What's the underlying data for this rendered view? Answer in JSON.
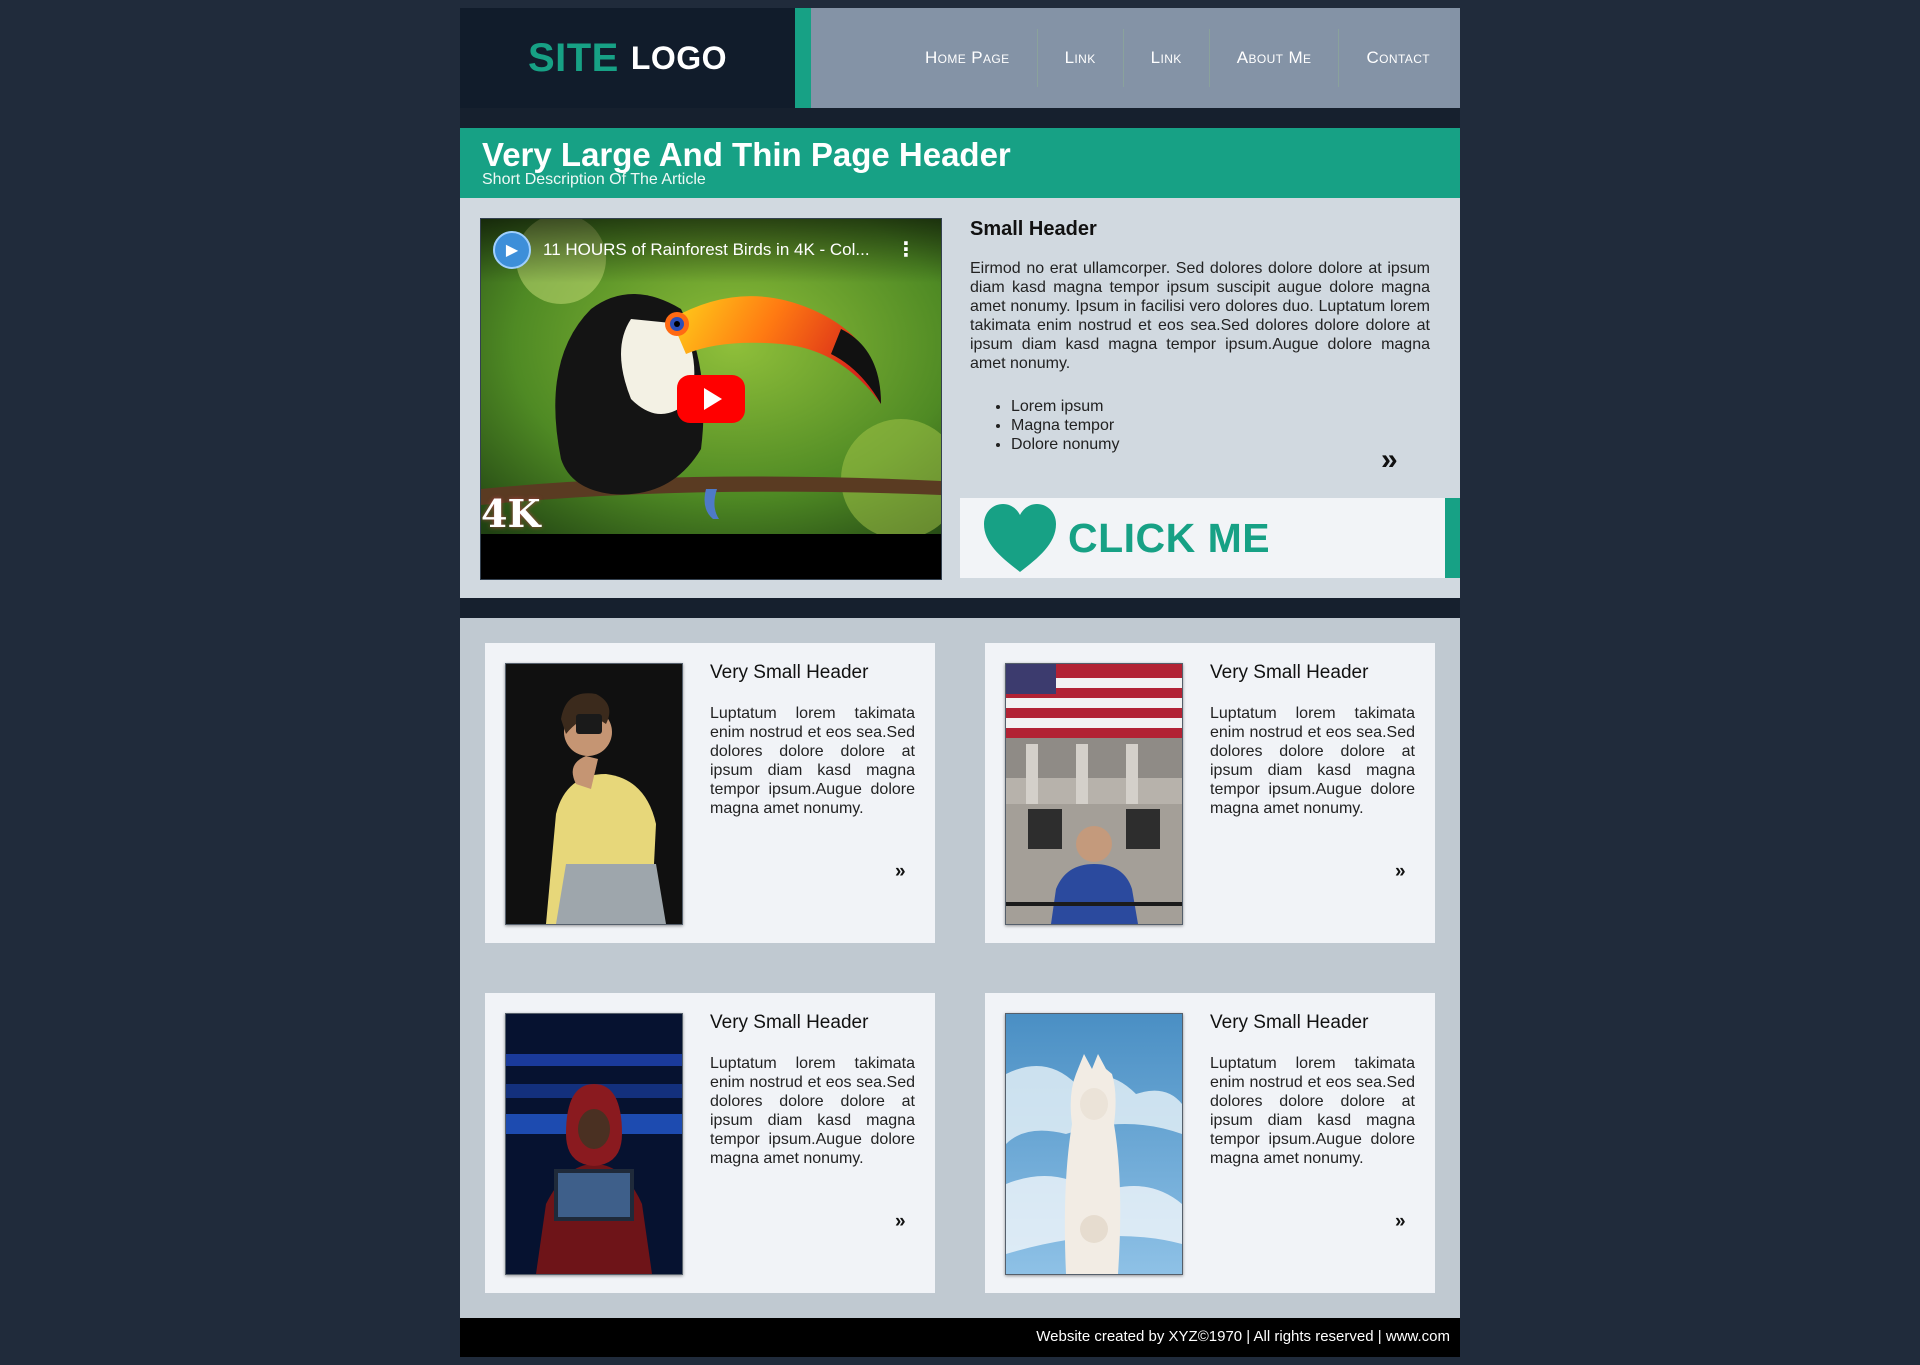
{
  "colors": {
    "accent": "#17a185",
    "nav_bg": "#8493a6",
    "dark": "#111c2b",
    "page_bg": "#202b3b"
  },
  "logo": {
    "part1": "SITE",
    "part2": "LOGO"
  },
  "nav": [
    {
      "label": "Home Page"
    },
    {
      "label": "Link"
    },
    {
      "label": "Link"
    },
    {
      "label": "About Me"
    },
    {
      "label": "Contact"
    }
  ],
  "header": {
    "title": "Very Large And Thin Page Header",
    "subtitle": "Short Description Of The Article"
  },
  "video": {
    "title": "11 HOURS of Rainforest Birds in 4K - Col...",
    "badge": "4K",
    "icons": [
      "channel-avatar-icon",
      "more-vert-icon",
      "youtube-play-icon"
    ]
  },
  "hero": {
    "heading": "Small Header",
    "body": "Eirmod no erat ullamcorper. Sed dolores dolore dolore at ipsum diam kasd magna tempor ipsum suscipit augue dolore magna amet nonumy. Ipsum in facilisi vero dolores duo. Luptatum lorem takimata enim nostrud et eos sea.Sed dolores dolore dolore at ipsum diam kasd magna tempor ipsum.Augue dolore magna amet nonumy.",
    "bullets": [
      "Lorem ipsum",
      "Magna tempor",
      "Dolore nonumy"
    ],
    "more_icon": "»",
    "cta_label": "CLICK ME"
  },
  "cards": [
    {
      "heading": "Very Small Header",
      "body": "Luptatum lorem takimata enim nostrud et eos sea.Sed dolores dolore dolore at ipsum diam kasd magna tempor ipsum.Augue dolore magna amet nonumy.",
      "more_icon": "»"
    },
    {
      "heading": "Very Small Header",
      "body": "Luptatum lorem takimata enim nostrud et eos sea.Sed dolores dolore dolore at ipsum diam kasd magna tempor ipsum.Augue dolore magna amet nonumy.",
      "more_icon": "»"
    },
    {
      "heading": "Very Small Header",
      "body": "Luptatum lorem takimata enim nostrud et eos sea.Sed dolores dolore dolore at ipsum diam kasd magna tempor ipsum.Augue dolore magna amet nonumy.",
      "more_icon": "»"
    },
    {
      "heading": "Very Small Header",
      "body": "Luptatum lorem takimata enim nostrud et eos sea.Sed dolores dolore dolore at ipsum diam kasd magna tempor ipsum.Augue dolore magna amet nonumy.",
      "more_icon": "»"
    }
  ],
  "footer": {
    "text": "Website created by XYZ©1970 | All rights reserved | www.com"
  }
}
